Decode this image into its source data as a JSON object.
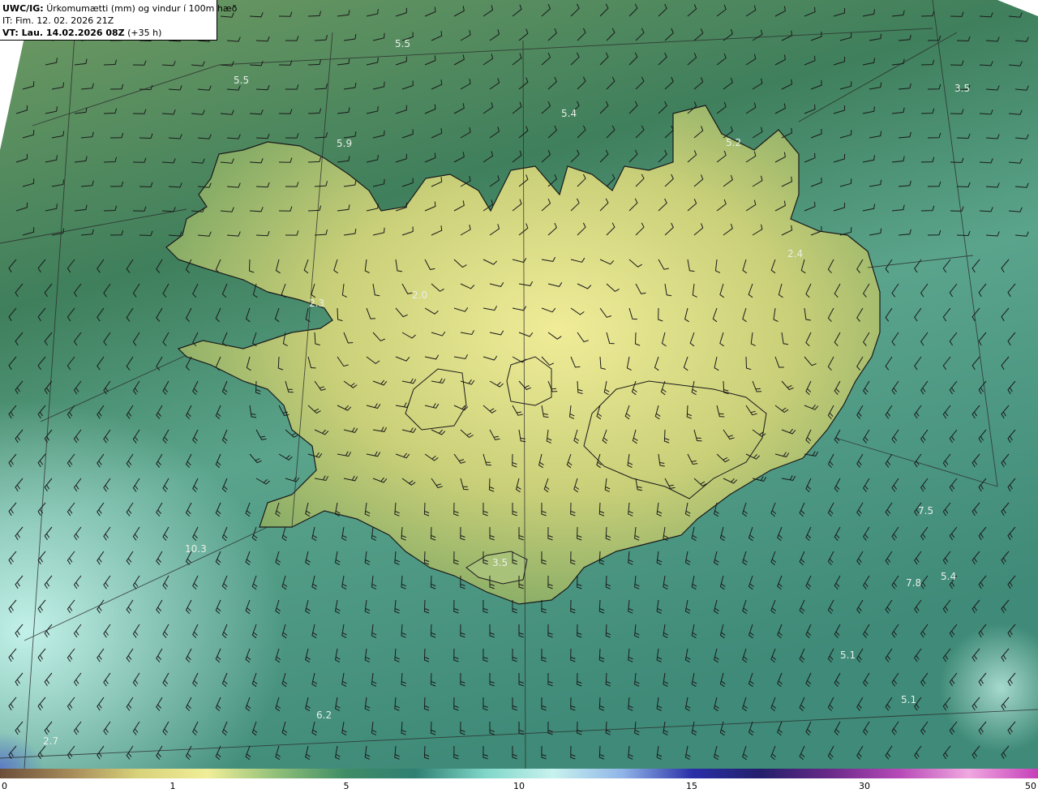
{
  "header": {
    "product": "UWC/IG:",
    "title": "Úrkomumætti (mm) og vindur í 100m hæð",
    "it_line": "IT: Fim. 12. 02. 2026 21Z",
    "vt_prefix": "VT: Lau. 14.02.2026 08Z",
    "vt_suffix": "(+35 h)"
  },
  "value_labels": [
    "5.5",
    "5.5",
    "5.4",
    "3.5",
    "5.9",
    "5.2",
    "2.4",
    "2.3",
    "2.0",
    "7.5",
    "10.3",
    "3.5",
    "7.8",
    "5.4",
    "5.1",
    "5.1",
    "6.2",
    "2.7"
  ],
  "colorbar": {
    "ticks": [
      "0",
      "1",
      "5",
      "10",
      "15",
      "30",
      "50"
    ],
    "colors": [
      "#6b4f3a",
      "#a58a5a",
      "#d8d27a",
      "#f0ee98",
      "#8fbf78",
      "#3f8c66",
      "#2f8073",
      "#7fd6c8",
      "#c8f2ee",
      "#8fb4e8",
      "#2a2fa8",
      "#231f6b",
      "#6a2a8a",
      "#b84ab8",
      "#f0a8e0",
      "#c63fb8"
    ]
  },
  "colors": {
    "ocean_dark": "#2e7559",
    "ocean_light": "#a8e6da",
    "land_yellow": "#e8e48a",
    "barb": "#1a1a1a"
  }
}
